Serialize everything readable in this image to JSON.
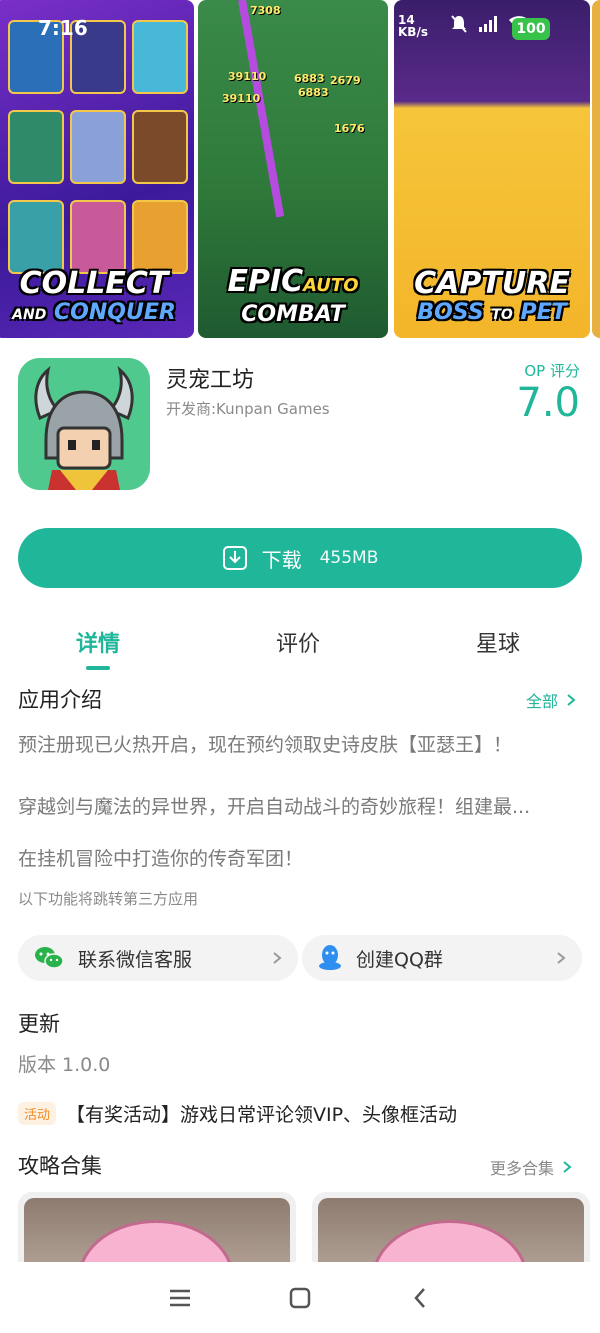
{
  "status_bar": {
    "time": "7:16",
    "net_speed": "14",
    "net_unit": "KB/s",
    "battery": "100"
  },
  "screenshots": [
    {
      "line1": "COLLECT",
      "line2a": "AND",
      "line2b": "CONQUER"
    },
    {
      "line1a": "EPIC",
      "line1b": "AUTO",
      "line2": "COMBAT",
      "numbers": [
        "7308",
        "39110",
        "6883",
        "2679",
        "1676",
        "6883",
        "39110"
      ]
    },
    {
      "line1": "CAPTURE",
      "line2a": "BOSS",
      "line2b": "TO",
      "line2c": "PET"
    }
  ],
  "app": {
    "name": "灵宠工坊",
    "developer": "开发商:Kunpan Games",
    "op_label": "OP 评分",
    "op_score": "7.0"
  },
  "download": {
    "label": "下载",
    "size": "455MB"
  },
  "tabs": [
    {
      "label": "详情"
    },
    {
      "label": "评价"
    },
    {
      "label": "星球"
    }
  ],
  "intro": {
    "title": "应用介绍",
    "more": "全部",
    "lines": [
      "预注册现已火热开启，现在预约领取史诗皮肤【亚瑟王】！",
      "穿越剑与魔法的异世界，开启自动战斗的奇妙旅程！组建最...",
      "在挂机冒险中打造你的传奇军团！"
    ],
    "note": "以下功能将跳转第三方应用"
  },
  "links": {
    "wechat": "联系微信客服",
    "qq": "创建QQ群"
  },
  "update": {
    "title": "更新",
    "version": "版本 1.0.0",
    "badge": "活动",
    "activity": "【有奖活动】游戏日常评论领VIP、头像框活动"
  },
  "guides": {
    "title": "攻略合集",
    "more": "更多合集"
  },
  "colors": {
    "accent": "#1fb69a",
    "badge_text": "#f08a24"
  }
}
